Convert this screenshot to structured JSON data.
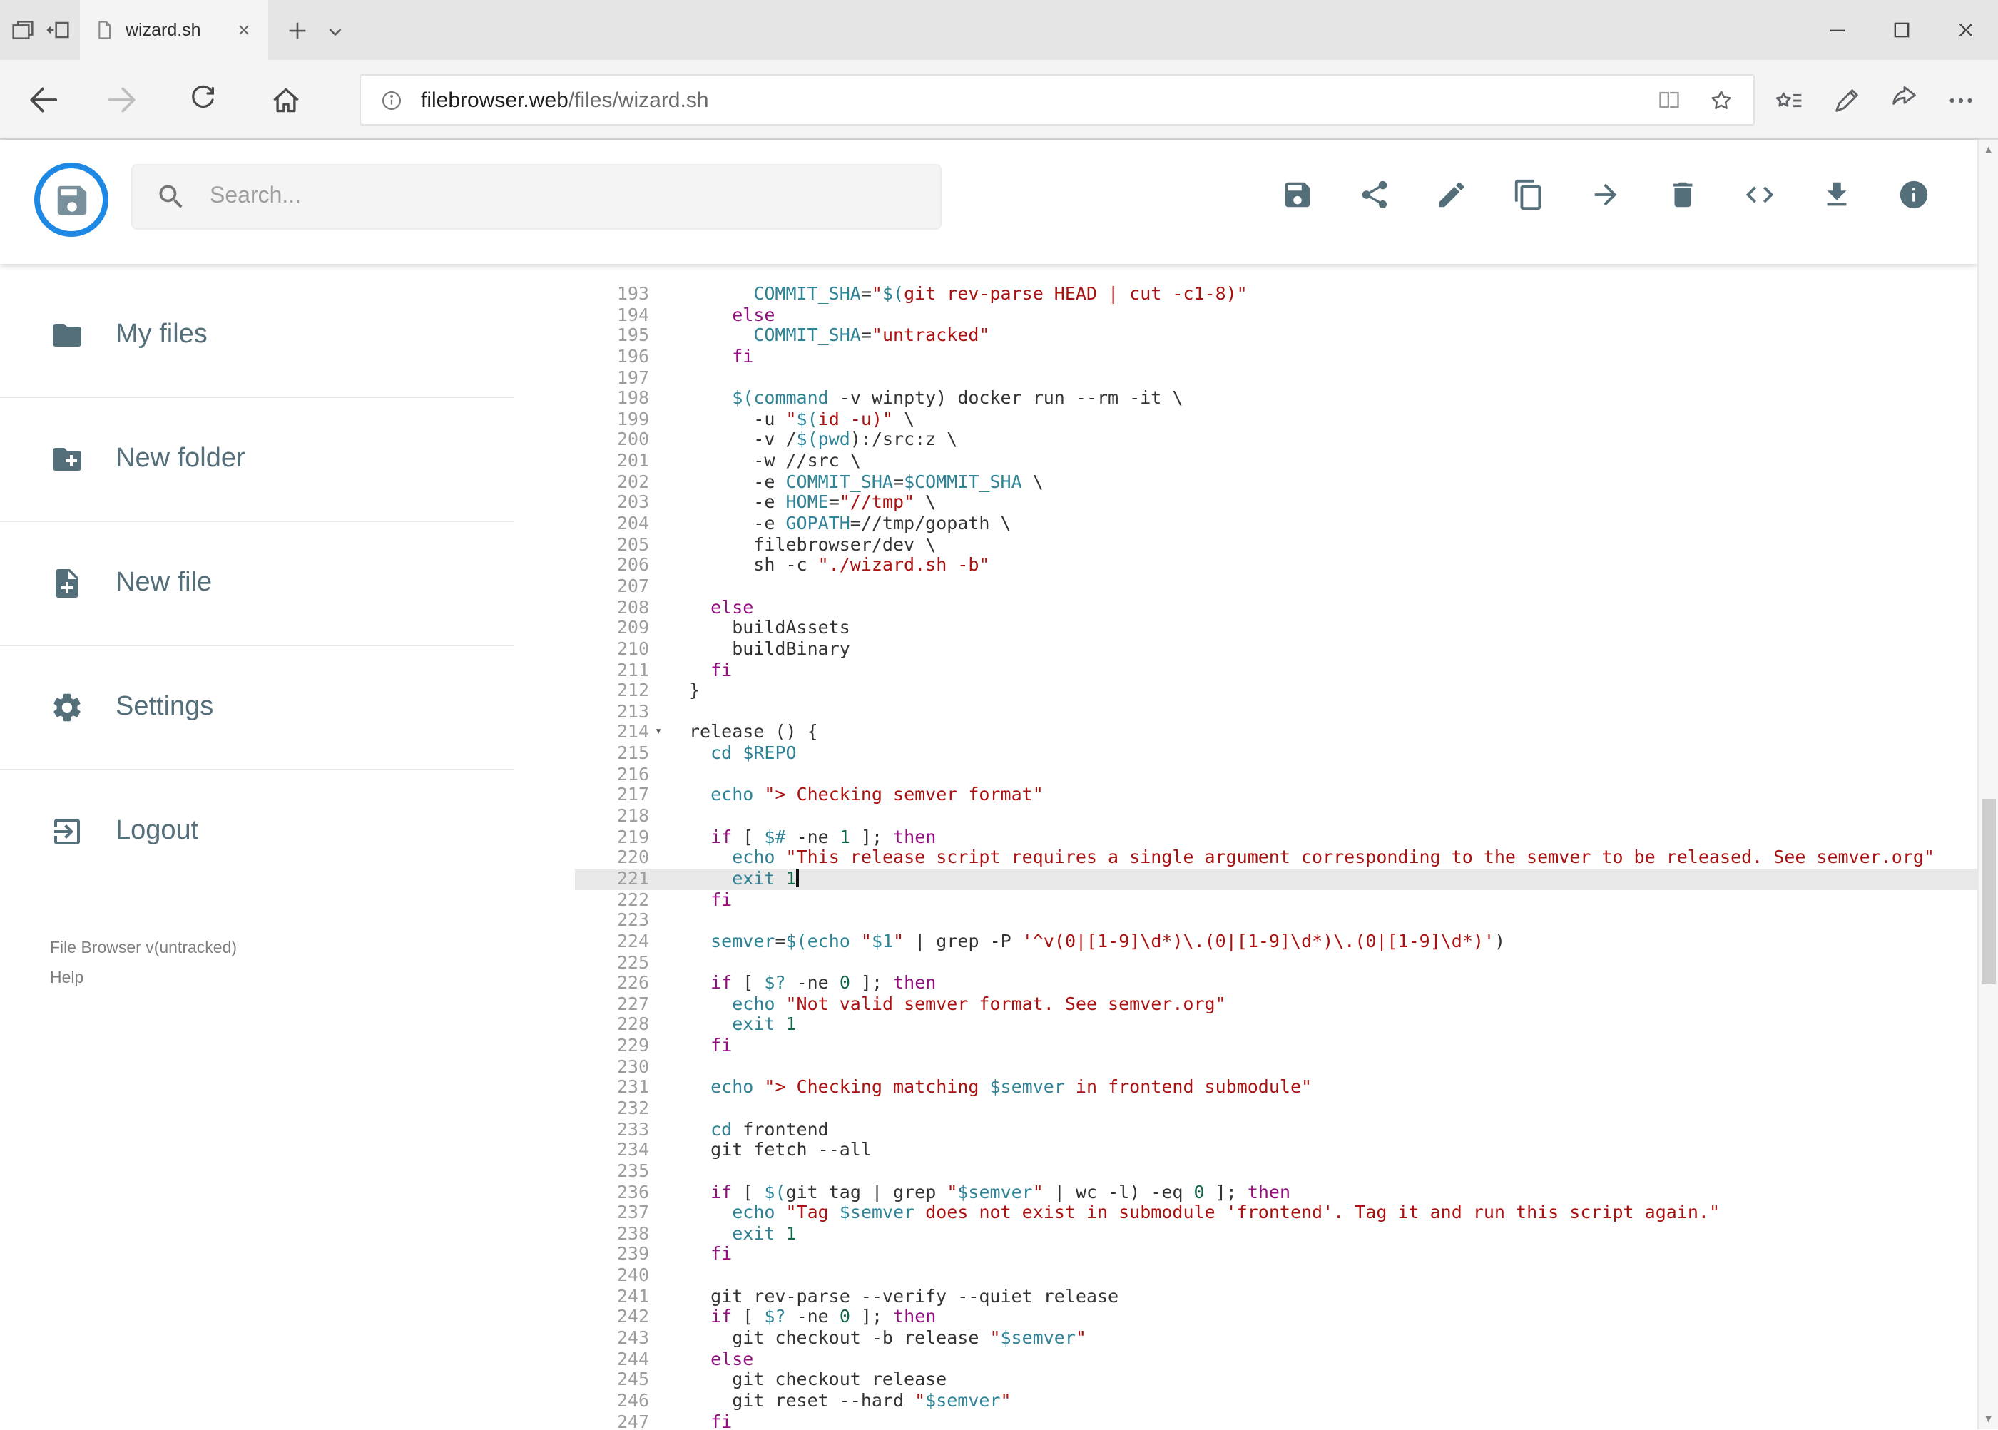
{
  "browser": {
    "tab": {
      "title": "wizard.sh"
    },
    "url": {
      "host": "filebrowser.web",
      "path": "/files/wizard.sh"
    }
  },
  "app": {
    "search_placeholder": "Search...",
    "toolbar": [
      {
        "name": "save",
        "icon": "save"
      },
      {
        "name": "share",
        "icon": "share"
      },
      {
        "name": "rename",
        "icon": "edit"
      },
      {
        "name": "copy",
        "icon": "copy"
      },
      {
        "name": "move",
        "icon": "move"
      },
      {
        "name": "delete",
        "icon": "delete"
      },
      {
        "name": "switch-view",
        "icon": "code"
      },
      {
        "name": "download",
        "icon": "download"
      },
      {
        "name": "info",
        "icon": "info"
      }
    ],
    "sidebar": {
      "items": [
        {
          "label": "My files",
          "icon": "folder"
        },
        {
          "label": "New folder",
          "icon": "new-folder"
        },
        {
          "label": "New file",
          "icon": "new-file"
        },
        {
          "label": "Settings",
          "icon": "settings"
        },
        {
          "label": "Logout",
          "icon": "logout"
        }
      ],
      "version": "File Browser v(untracked)",
      "help": "Help"
    }
  },
  "editor": {
    "first_line_number": 193,
    "active_line_number": 221,
    "fold_line_number": 214,
    "lines": [
      "      COMMIT_SHA=\"$(git rev-parse HEAD | cut -c1-8)\"",
      "    else",
      "      COMMIT_SHA=\"untracked\"",
      "    fi",
      "",
      "    $(command -v winpty) docker run --rm -it \\",
      "      -u \"$(id -u)\" \\",
      "      -v /$(pwd):/src:z \\",
      "      -w //src \\",
      "      -e COMMIT_SHA=$COMMIT_SHA \\",
      "      -e HOME=\"//tmp\" \\",
      "      -e GOPATH=//tmp/gopath \\",
      "      filebrowser/dev \\",
      "      sh -c \"./wizard.sh -b\"",
      "",
      "  else",
      "    buildAssets",
      "    buildBinary",
      "  fi",
      "}",
      "",
      "release () {",
      "  cd $REPO",
      "",
      "  echo \"> Checking semver format\"",
      "",
      "  if [ $# -ne 1 ]; then",
      "    echo \"This release script requires a single argument corresponding to the semver to be released. See semver.org\"",
      "    exit 1",
      "  fi",
      "",
      "  semver=$(echo \"$1\" | grep -P '^v(0|[1-9]\\d*)\\.(0|[1-9]\\d*)\\.(0|[1-9]\\d*)')",
      "",
      "  if [ $? -ne 0 ]; then",
      "    echo \"Not valid semver format. See semver.org\"",
      "    exit 1",
      "  fi",
      "",
      "  echo \"> Checking matching $semver in frontend submodule\"",
      "",
      "  cd frontend",
      "  git fetch --all",
      "",
      "  if [ $(git tag | grep \"$semver\" | wc -l) -eq 0 ]; then",
      "    echo \"Tag $semver does not exist in submodule 'frontend'. Tag it and run this script again.\"",
      "    exit 1",
      "  fi",
      "",
      "  git rev-parse --verify --quiet release",
      "  if [ $? -ne 0 ]; then",
      "    git checkout -b release \"$semver\"",
      "  else",
      "    git checkout release",
      "    git reset --hard \"$semver\"",
      "  fi"
    ]
  },
  "colors": {
    "accent": "#1e88e5",
    "toolbar_icon": "#546e7a",
    "keyword": "#930f80",
    "variable": "#2f8396",
    "string": "#aa1111",
    "number": "#116644",
    "active_line": "#e9e9e9"
  }
}
